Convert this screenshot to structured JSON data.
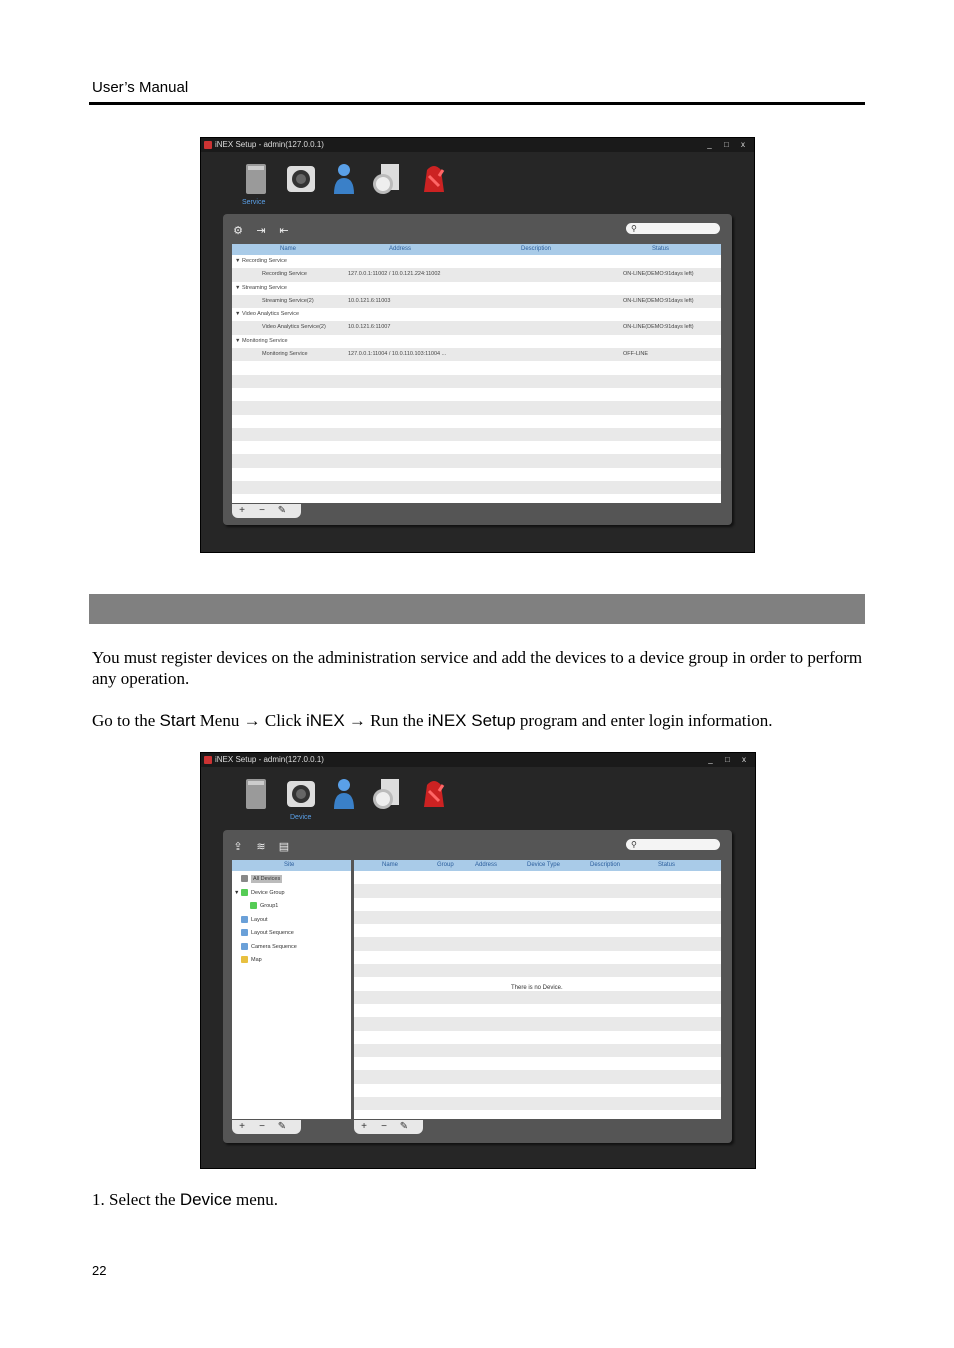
{
  "header": {
    "title": "User’s Manual"
  },
  "section_heading": "",
  "paragraphs": {
    "p1": "You must register devices on the administration service and add the devices to a device group in order to perform any operation.",
    "p2_a": "Go to the ",
    "p2_start": "Start",
    "p2_b": " Menu → Click ",
    "p2_inex": "iNEX",
    "p2_c": " → Run the ",
    "p2_setup": "iNEX Setup",
    "p2_d": " program and enter login information."
  },
  "step1": {
    "a": "1.  Select the ",
    "b": "Device",
    "c": " menu."
  },
  "page_number": "22",
  "screenshot1": {
    "window_title": "iNEX Setup - admin(127.0.0.1)",
    "window_buttons": "_ □ x",
    "active_label": "Service",
    "columns": [
      "Name",
      "Address",
      "Description",
      "Status"
    ],
    "rows": [
      {
        "name": "▼ Recording Service",
        "address": "",
        "status": ""
      },
      {
        "name": "Recording Service",
        "address": "127.0.0.1:11002  /  10.0.121.224:11002",
        "status": "ON-LINE(DEMO:91days left)"
      },
      {
        "name": "▼ Streaming Service",
        "address": "",
        "status": ""
      },
      {
        "name": "Streaming Service(2)",
        "address": "10.0.121.6:11003",
        "status": "ON-LINE(DEMO:91days left)"
      },
      {
        "name": "▼ Video Analytics Service",
        "address": "",
        "status": ""
      },
      {
        "name": "Video Analytics Service(2)",
        "address": "10.0.121.6:11007",
        "status": "ON-LINE(DEMO:91days left)"
      },
      {
        "name": "▼ Monitoring Service",
        "address": "",
        "status": ""
      },
      {
        "name": "Monitoring Service",
        "address": "127.0.0.1:11004  /  10.0.110.103:11004 ...",
        "status": "OFF-LINE"
      }
    ],
    "bottom_buttons": [
      "+",
      "−",
      "✎"
    ]
  },
  "screenshot2": {
    "window_title": "iNEX Setup - admin(127.0.0.1)",
    "window_buttons": "_ □ x",
    "active_label": "Device",
    "tree_header": "Site",
    "tree": [
      "All Devices",
      "Device Group",
      "Group1",
      "Layout",
      "Layout Sequence",
      "Camera Sequence",
      "Map"
    ],
    "columns": [
      "Name",
      "Group",
      "Address",
      "Device Type",
      "Description",
      "Status"
    ],
    "empty_message": "There is no Device.",
    "bottom_buttons": [
      "+",
      "−",
      "✎"
    ]
  },
  "colors": {
    "section_bar": "#808080",
    "header_blue": "#a9cbe8"
  }
}
